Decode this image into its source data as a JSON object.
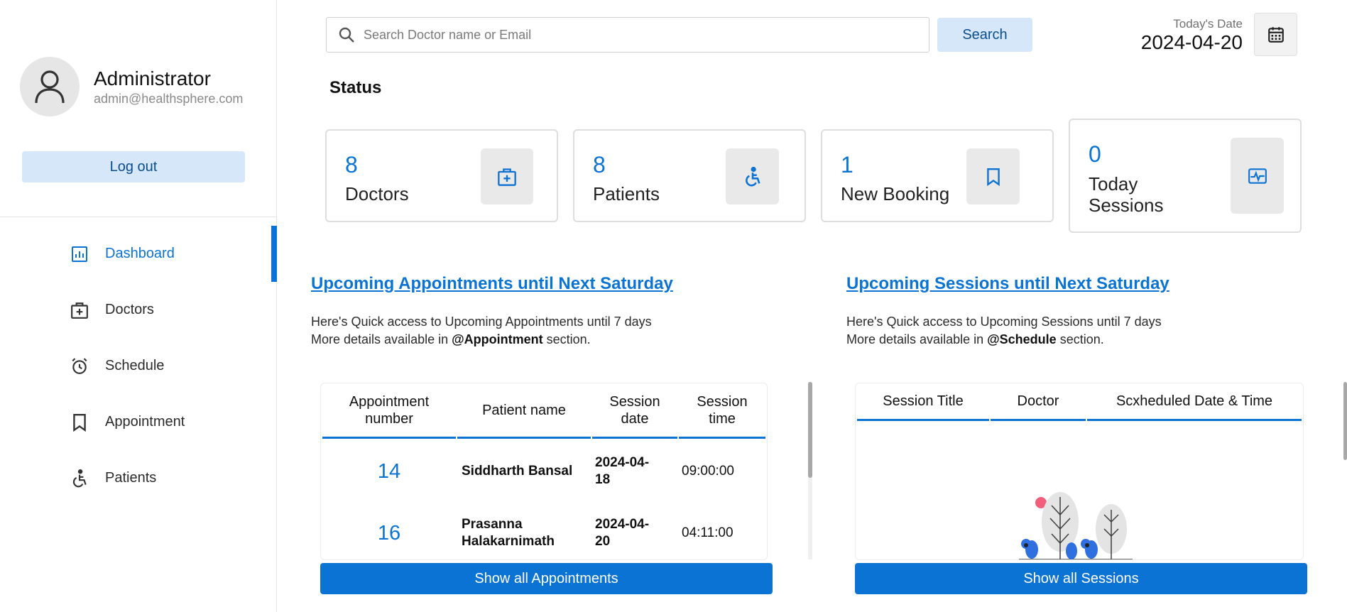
{
  "user": {
    "name": "Administrator",
    "email": "admin@healthsphere.com",
    "logout_label": "Log out"
  },
  "sidebar": {
    "items": [
      {
        "label": "Dashboard",
        "icon": "dashboard-icon",
        "active": true
      },
      {
        "label": "Doctors",
        "icon": "medical-kit-icon"
      },
      {
        "label": "Schedule",
        "icon": "alarm-clock-icon"
      },
      {
        "label": "Appointment",
        "icon": "bookmark-icon"
      },
      {
        "label": "Patients",
        "icon": "wheelchair-icon"
      }
    ]
  },
  "search": {
    "placeholder": "Search Doctor name or Email",
    "value": "",
    "button_label": "Search"
  },
  "date": {
    "label": "Today's Date",
    "value": "2024-04-20"
  },
  "status": {
    "title": "Status",
    "cards": [
      {
        "value": "8",
        "label": "Doctors",
        "icon": "medical-kit-icon"
      },
      {
        "value": "8",
        "label": "Patients",
        "icon": "wheelchair-icon"
      },
      {
        "value": "1",
        "label": "New Booking",
        "icon": "bookmark-icon"
      },
      {
        "value": "0",
        "label_line1": "Today",
        "label_line2": "Sessions",
        "icon": "pulse-monitor-icon"
      }
    ]
  },
  "appointments": {
    "title": "Upcoming Appointments until Next Saturday",
    "desc_line1": "Here's Quick access to Upcoming Appointments until 7 days",
    "desc_prefix": "More details available in ",
    "desc_link": "@Appointment",
    "desc_suffix": " section.",
    "columns": [
      {
        "line1": "Appointment",
        "line2": "number"
      },
      {
        "line1": "Patient name",
        "line2": ""
      },
      {
        "line1": "Session",
        "line2": "date"
      },
      {
        "line1": "Session",
        "line2": "time"
      }
    ],
    "rows": [
      {
        "number": "14",
        "patient": "Siddharth Bansal",
        "date_line1": "2024-04-",
        "date_line2": "18",
        "time": "09:00:00"
      },
      {
        "number": "16",
        "patient_line1": "Prasanna",
        "patient_line2": "Halakarnimath",
        "date_line1": "2024-04-",
        "date_line2": "20",
        "time": "04:11:00"
      }
    ],
    "button_label": "Show all Appointments"
  },
  "sessions": {
    "title": "Upcoming Sessions until Next Saturday",
    "desc_line1": "Here's Quick access to Upcoming Sessions until 7 days",
    "desc_prefix": "More details available in ",
    "desc_link": "@Schedule",
    "desc_suffix": " section.",
    "columns": [
      "Session Title",
      "Doctor",
      "Scxheduled Date & Time"
    ],
    "empty_illustration": "empty-plants-illustration",
    "button_label": "Show all Sessions"
  },
  "colors": {
    "accent": "#0b73d4",
    "light_accent": "#d5e7f8",
    "card_icon_bg": "#e9e9e9"
  }
}
